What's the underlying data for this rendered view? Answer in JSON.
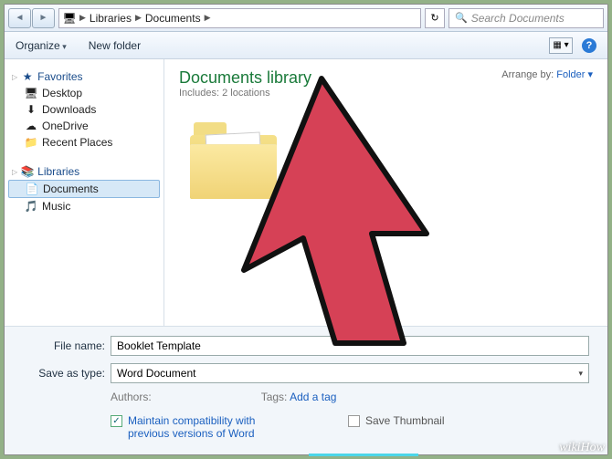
{
  "breadcrumbs": {
    "b1": "Libraries",
    "b2": "Documents"
  },
  "search": {
    "placeholder": "Search Documents"
  },
  "toolbar": {
    "organize": "Organize",
    "newfolder": "New folder"
  },
  "nav": {
    "favorites": "Favorites",
    "desktop": "Desktop",
    "downloads": "Downloads",
    "onedrive": "OneDrive",
    "recent": "Recent Places",
    "libraries": "Libraries",
    "documents": "Documents",
    "music": "Music"
  },
  "library": {
    "title": "Documents library",
    "subtitle": "Includes: 2 locations",
    "arrange_label": "Arrange by:",
    "arrange_value": "Folder ▾"
  },
  "form": {
    "filename_label": "File name:",
    "filename_value": "Booklet Template",
    "savetype_label": "Save as type:",
    "savetype_value": "Word Document",
    "authors_label": "Authors:",
    "tags_label": "Tags:",
    "tags_value": "Add a tag",
    "compat": "Maintain compatibility with previous versions of Word",
    "thumb": "Save Thumbnail"
  },
  "watermark": "wikiHow"
}
